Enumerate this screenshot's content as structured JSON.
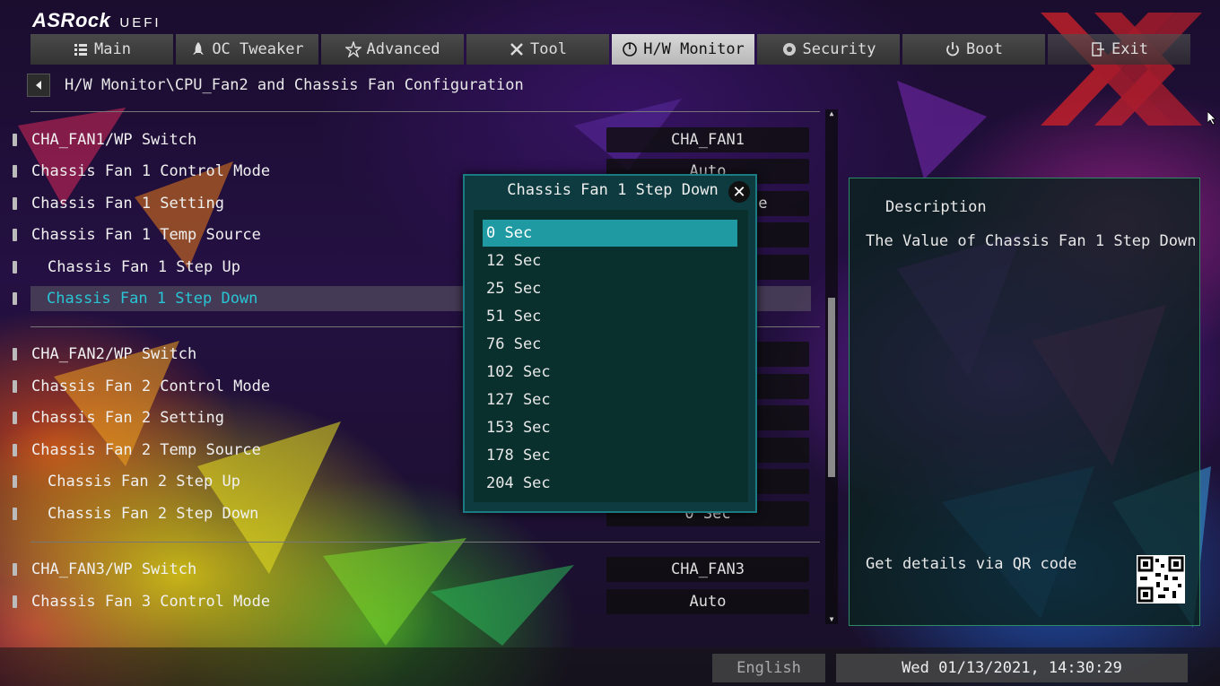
{
  "brand": {
    "logo": "ASRock",
    "logo_suffix": "UEFI"
  },
  "nav": {
    "tabs": [
      {
        "label": "Main",
        "icon": "list-icon"
      },
      {
        "label": "OC Tweaker",
        "icon": "rocket-icon"
      },
      {
        "label": "Advanced",
        "icon": "star-icon"
      },
      {
        "label": "Tool",
        "icon": "tools-icon"
      },
      {
        "label": "H/W Monitor",
        "icon": "monitor-icon",
        "active": true
      },
      {
        "label": "Security",
        "icon": "shield-icon"
      },
      {
        "label": "Boot",
        "icon": "power-icon"
      },
      {
        "label": "Exit",
        "icon": "exit-icon"
      }
    ]
  },
  "breadcrumb": {
    "path": "H/W Monitor\\CPU_Fan2 and Chassis Fan Configuration"
  },
  "settings": [
    {
      "label": "CHA_FAN1/WP Switch",
      "value": "CHA_FAN1",
      "sub": false
    },
    {
      "label": "Chassis Fan 1 Control Mode",
      "value": "Auto",
      "sub": false
    },
    {
      "label": "Chassis Fan 1 Setting",
      "value": "Standard Mode",
      "sub": false
    },
    {
      "label": "Chassis Fan 1 Temp Source",
      "value": "",
      "sub": false
    },
    {
      "label": "Chassis Fan 1 Step Up",
      "value": "",
      "sub": true
    },
    {
      "label": "Chassis Fan 1 Step Down",
      "value": "",
      "sub": true,
      "selected": true
    },
    {
      "label": "CHA_FAN2/WP Switch",
      "value": "",
      "sub": false
    },
    {
      "label": "Chassis Fan 2 Control Mode",
      "value": "",
      "sub": false
    },
    {
      "label": "Chassis Fan 2 Setting",
      "value": "",
      "sub": false
    },
    {
      "label": "Chassis Fan 2 Temp Source",
      "value": "",
      "sub": false
    },
    {
      "label": "Chassis Fan 2 Step Up",
      "value": "",
      "sub": true
    },
    {
      "label": "Chassis Fan 2 Step Down",
      "value": "0 Sec",
      "sub": true
    },
    {
      "label": "CHA_FAN3/WP Switch",
      "value": "CHA_FAN3",
      "sub": false
    },
    {
      "label": "Chassis Fan 3 Control Mode",
      "value": "Auto",
      "sub": false
    }
  ],
  "popup": {
    "title": "Chassis Fan 1 Step Down",
    "close_icon": "close-icon",
    "options": [
      "0 Sec",
      "12 Sec",
      "25 Sec",
      "51 Sec",
      "76 Sec",
      "102 Sec",
      "127 Sec",
      "153 Sec",
      "178 Sec",
      "204 Sec"
    ],
    "selected_index": 0
  },
  "description": {
    "title": "Description",
    "text": "The Value of Chassis Fan 1 Step Down",
    "qr_text": "Get details via QR code"
  },
  "footer": {
    "language": "English",
    "datetime": "Wed 01/13/2021, 14:30:29"
  },
  "colors": {
    "accent": "#29c5d4",
    "popup_bg": "#0d3b3f",
    "selected_option": "#1f9aa3"
  }
}
